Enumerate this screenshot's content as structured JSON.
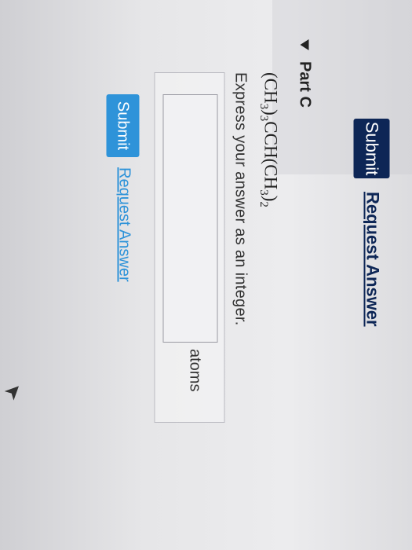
{
  "top_actions": {
    "submit_label": "Submit",
    "request_answer_label": "Request Answer"
  },
  "part": {
    "title": "Part C",
    "formula_segments": [
      "(CH",
      "3",
      ")",
      "3",
      "CCH(CH",
      "3",
      ")",
      "2"
    ],
    "instruction": "Express your answer as an integer.",
    "answer": {
      "value": "",
      "unit": "atoms"
    },
    "submit_label": "Submit",
    "request_answer_label": "Request Answer"
  },
  "colors": {
    "dark_button": "#0d2656",
    "accent": "#2e93d9"
  },
  "icons": {
    "collapse": "caret-down-icon",
    "pointer": "mouse-cursor-icon"
  }
}
